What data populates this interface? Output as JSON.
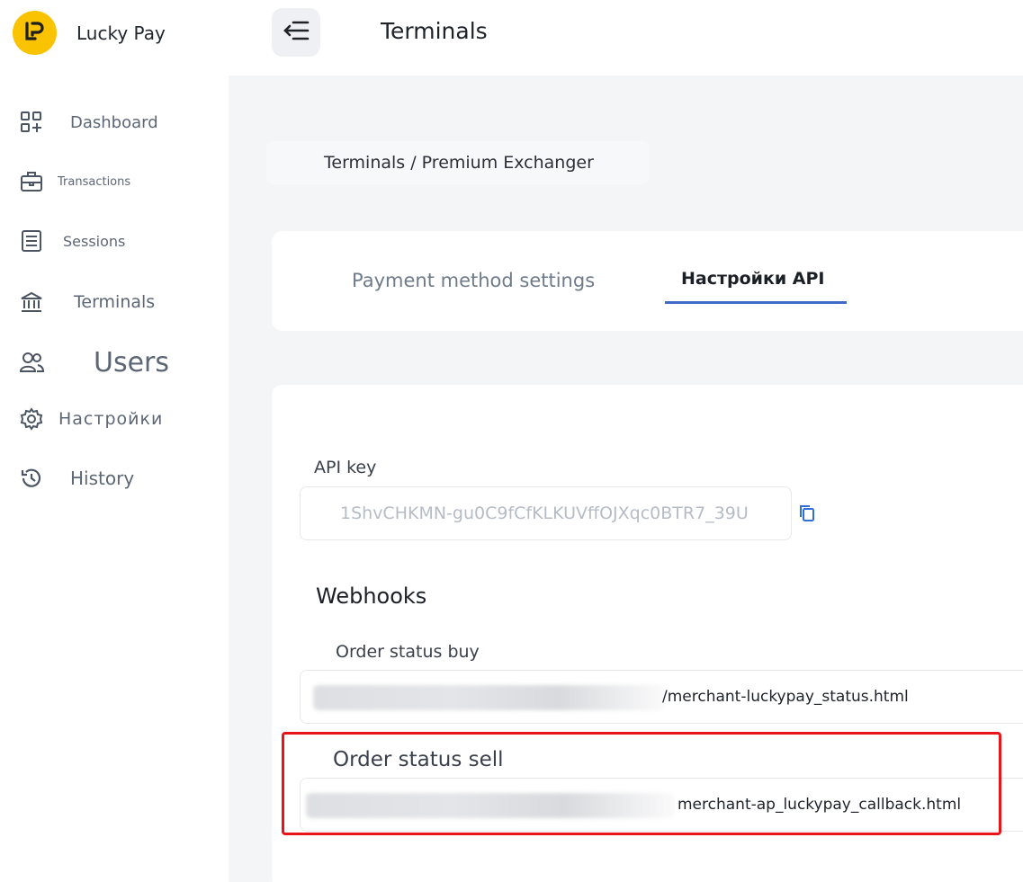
{
  "brand": {
    "name": "Lucky Pay",
    "logo_icon": "lucky-pay-logo-icon",
    "logo_color": "#f9c301"
  },
  "sidebar": {
    "items": [
      {
        "label": "Dashboard",
        "icon": "dashboard-grid-icon"
      },
      {
        "label": "Transactions",
        "icon": "briefcase-icon"
      },
      {
        "label": "Sessions",
        "icon": "document-list-icon"
      },
      {
        "label": "Terminals",
        "icon": "bank-icon"
      },
      {
        "label": "Users",
        "icon": "users-icon"
      },
      {
        "label": "Настройки",
        "icon": "gear-icon"
      },
      {
        "label": "History",
        "icon": "history-icon"
      }
    ]
  },
  "header": {
    "title": "Terminals",
    "menu_icon": "collapse-menu-icon"
  },
  "breadcrumb": "Terminals / Premium Exchanger",
  "tabs": [
    {
      "label": "Payment method settings",
      "active": false
    },
    {
      "label": "Настройки API",
      "active": true
    }
  ],
  "api": {
    "label": "API key",
    "value": "1ShvCHKMN-gu0C9fCfKLKUVffOJXqc0BTR7_39U",
    "copy_icon": "copy-icon"
  },
  "webhooks": {
    "title": "Webhooks",
    "buy": {
      "label": "Order status buy",
      "value": "/merchant-luckypay_status.html"
    },
    "sell": {
      "label": "Order status sell",
      "value": "merchant-ap_luckypay_callback.html"
    }
  },
  "colors": {
    "accent": "#3f6ac7",
    "highlight": "#e8141a"
  }
}
